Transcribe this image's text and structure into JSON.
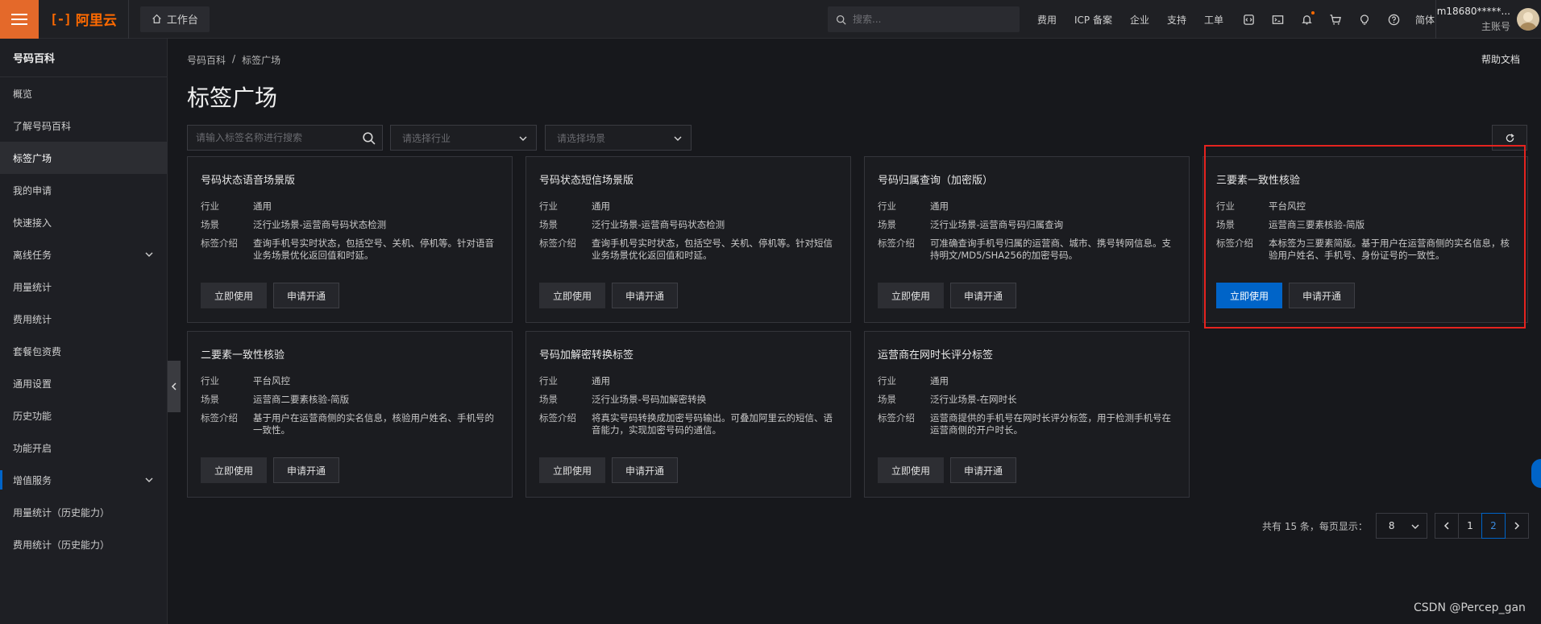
{
  "topbar": {
    "brand_name": "阿里云",
    "workbench": "工作台",
    "search_placeholder": "搜索...",
    "nav_links": [
      "费用",
      "ICP 备案",
      "企业",
      "支持",
      "工单"
    ],
    "lang": "简体",
    "user_name": "m18680*****...",
    "user_role": "主账号",
    "icons": [
      "code-icon",
      "terminal-icon",
      "bell-icon",
      "cart-icon",
      "lightbulb-icon",
      "help-icon"
    ],
    "accent": "#ff6a00"
  },
  "sidebar": {
    "title": "号码百科",
    "items": [
      {
        "label": "概览"
      },
      {
        "label": "了解号码百科"
      },
      {
        "label": "标签广场"
      },
      {
        "label": "我的申请"
      },
      {
        "label": "快速接入"
      },
      {
        "label": "离线任务"
      },
      {
        "label": "用量统计"
      },
      {
        "label": "费用统计"
      },
      {
        "label": "套餐包资费"
      },
      {
        "label": "通用设置"
      },
      {
        "label": "历史功能"
      },
      {
        "label": "功能开启"
      },
      {
        "label": "增值服务"
      },
      {
        "label": "用量统计（历史能力）"
      },
      {
        "label": "费用统计（历史能力）"
      }
    ]
  },
  "breadcrumb": {
    "root": "号码百科",
    "sep": "/",
    "current": "标签广场"
  },
  "help_link": "帮助文档",
  "page_title": "标签广场",
  "filters": {
    "search_placeholder": "请输入标签名称进行搜索",
    "industry_placeholder": "请选择行业",
    "scene_placeholder": "请选择场景"
  },
  "labels": {
    "industry": "行业",
    "scene": "场景",
    "intro": "标签介绍",
    "use": "立即使用",
    "apply": "申请开通"
  },
  "cards": [
    {
      "title": "号码状态语音场景版",
      "industry": "通用",
      "scene": "泛行业场景-运营商号码状态检测",
      "intro": "查询手机号实时状态，包括空号、关机、停机等。针对语音业务场景优化返回值和时延。"
    },
    {
      "title": "号码状态短信场景版",
      "industry": "通用",
      "scene": "泛行业场景-运营商号码状态检测",
      "intro": "查询手机号实时状态，包括空号、关机、停机等。针对短信业务场景优化返回值和时延。"
    },
    {
      "title": "号码归属查询（加密版）",
      "industry": "通用",
      "scene": "泛行业场景-运营商号码归属查询",
      "intro": "可准确查询手机号归属的运营商、城市、携号转网信息。支持明文/MD5/SHA256的加密号码。"
    },
    {
      "title": "三要素一致性核验",
      "industry": "平台风控",
      "scene": "运营商三要素核验-简版",
      "intro": "本标签为三要素简版。基于用户在运营商侧的实名信息，核验用户姓名、手机号、身份证号的一致性。"
    },
    {
      "title": "二要素一致性核验",
      "industry": "平台风控",
      "scene": "运营商二要素核验-简版",
      "intro": "基于用户在运营商侧的实名信息，核验用户姓名、手机号的一致性。"
    },
    {
      "title": "号码加解密转换标签",
      "industry": "通用",
      "scene": "泛行业场景-号码加解密转换",
      "intro": "将真实号码转换成加密号码输出。可叠加阿里云的短信、语音能力，实现加密号码的通信。"
    },
    {
      "title": "运营商在网时长评分标签",
      "industry": "通用",
      "scene": "泛行业场景-在网时长",
      "intro": "运营商提供的手机号在网时长评分标签，用于检测手机号在运营商侧的开户时长。"
    }
  ],
  "pagination": {
    "info": "共有 15 条，每页显示：",
    "page_size": "8",
    "pages": [
      "1",
      "2"
    ],
    "current": "2"
  },
  "watermark": "CSDN @Percep_gan"
}
